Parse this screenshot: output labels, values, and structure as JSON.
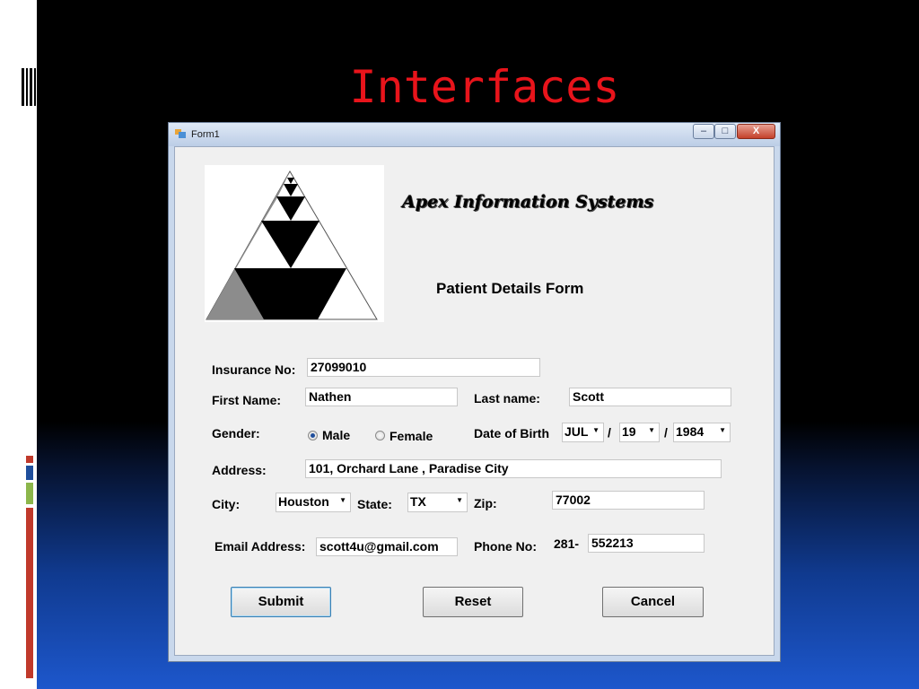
{
  "slide": {
    "title": "Interfaces"
  },
  "window": {
    "title": "Form1",
    "minimize_glyph": "–",
    "maximize_glyph": "□",
    "close_glyph": "X"
  },
  "form": {
    "company": "Apex Information Systems",
    "heading": "Patient  Details Form",
    "insurance": {
      "label": "Insurance No:",
      "value": "27099010"
    },
    "first_name": {
      "label": "First Name:",
      "value": "Nathen"
    },
    "last_name": {
      "label": "Last name:",
      "value": "Scott"
    },
    "gender": {
      "label": "Gender:",
      "options": [
        "Male",
        "Female"
      ],
      "selected": "Male"
    },
    "dob": {
      "label": "Date of Birth",
      "month": "JUL",
      "day": "19",
      "year": "1984",
      "separator": "/"
    },
    "address": {
      "label": "Address:",
      "value": "101, Orchard Lane , Paradise City"
    },
    "city": {
      "label": "City:",
      "value": "Houston"
    },
    "state": {
      "label": "State:",
      "value": "TX"
    },
    "zip": {
      "label": "Zip:",
      "value": "77002"
    },
    "email": {
      "label": "Email Address:",
      "value": "scott4u@gmail.com"
    },
    "phone": {
      "label": "Phone No:",
      "area": "281-",
      "number": "552213"
    },
    "buttons": {
      "submit": "Submit",
      "reset": "Reset",
      "cancel": "Cancel"
    }
  },
  "colors": {
    "title_red": "#e8141b",
    "accent_red": "#c0392b",
    "accent_blue": "#1f4e9c",
    "accent_green": "#8cb64b"
  }
}
